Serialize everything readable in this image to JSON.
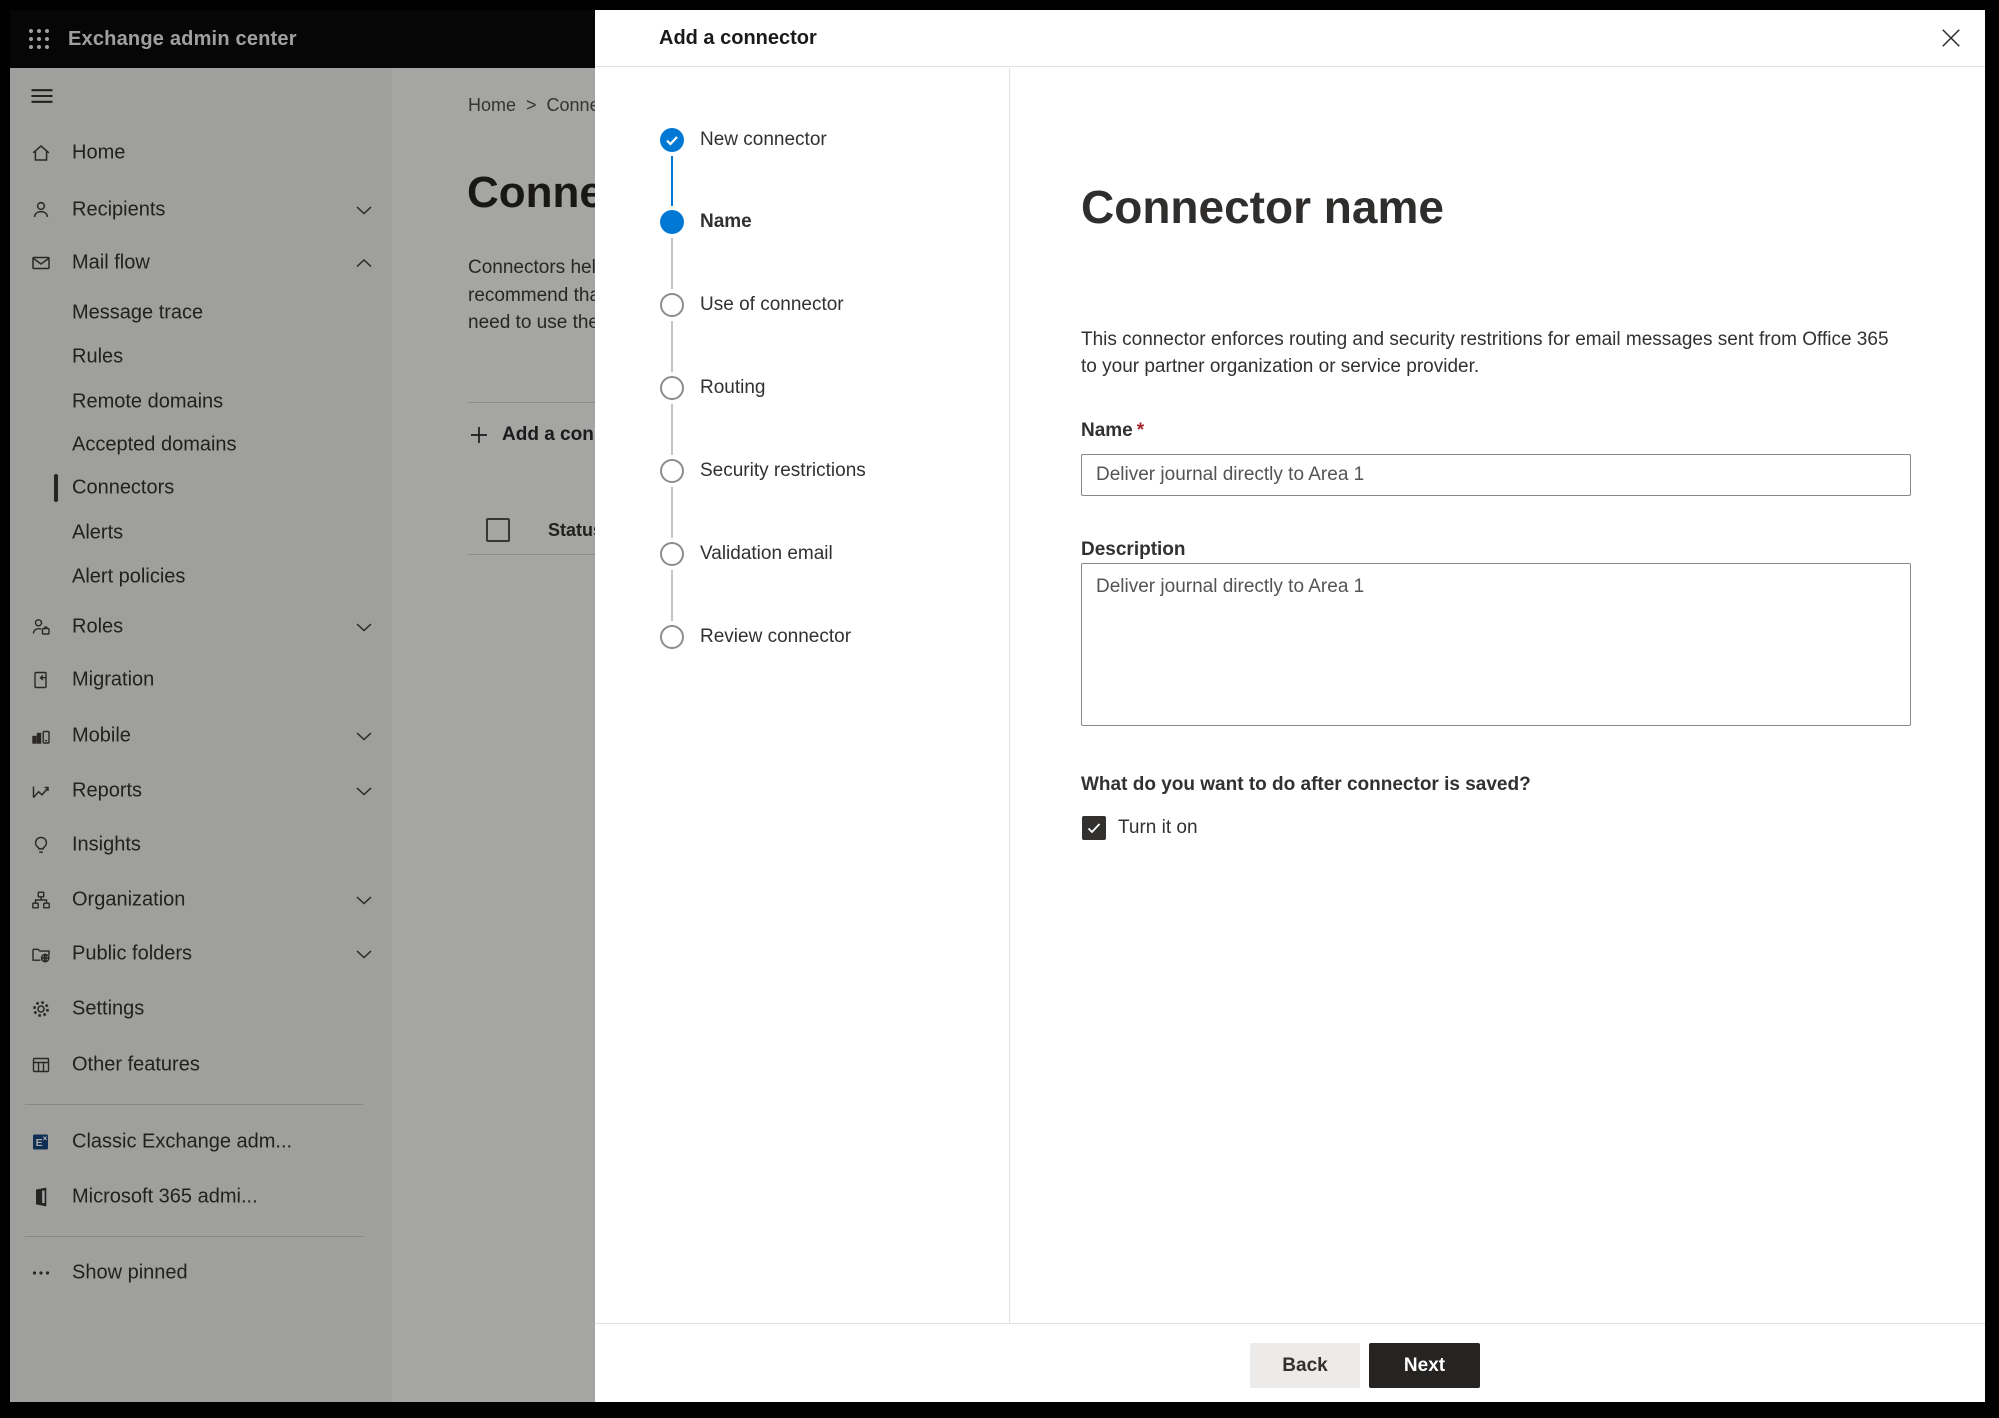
{
  "header": {
    "app_title": "Exchange admin center"
  },
  "sidebar": {
    "items": [
      {
        "label": "Home"
      },
      {
        "label": "Recipients"
      },
      {
        "label": "Mail flow"
      },
      {
        "label": "Message trace"
      },
      {
        "label": "Rules"
      },
      {
        "label": "Remote domains"
      },
      {
        "label": "Accepted domains"
      },
      {
        "label": "Connectors"
      },
      {
        "label": "Alerts"
      },
      {
        "label": "Alert policies"
      },
      {
        "label": "Roles"
      },
      {
        "label": "Migration"
      },
      {
        "label": "Mobile"
      },
      {
        "label": "Reports"
      },
      {
        "label": "Insights"
      },
      {
        "label": "Organization"
      },
      {
        "label": "Public folders"
      },
      {
        "label": "Settings"
      },
      {
        "label": "Other features"
      },
      {
        "label": "Classic Exchange adm..."
      },
      {
        "label": "Microsoft 365 admi..."
      },
      {
        "label": "Show pinned"
      }
    ]
  },
  "background": {
    "breadcrumb": {
      "home": "Home",
      "separator": ">",
      "current": "Conne"
    },
    "page_title": "Connec",
    "intro_lines": [
      "Connectors help",
      "recommend that",
      "need to use ther"
    ],
    "add_button_label": "Add a conn",
    "table": {
      "status_header": "Status"
    }
  },
  "dialog": {
    "title": "Add a connector",
    "steps": [
      {
        "label": "New connector",
        "state": "completed"
      },
      {
        "label": "Name",
        "state": "active"
      },
      {
        "label": "Use of connector",
        "state": "upcoming"
      },
      {
        "label": "Routing",
        "state": "upcoming"
      },
      {
        "label": "Security restrictions",
        "state": "upcoming"
      },
      {
        "label": "Validation email",
        "state": "upcoming"
      },
      {
        "label": "Review connector",
        "state": "upcoming"
      }
    ],
    "content": {
      "heading": "Connector name",
      "description_lines": [
        "This connector enforces routing and security restritions for email messages sent from Office 365",
        "to your partner organization or service provider."
      ],
      "name_label": "Name",
      "required_marker": "*",
      "name_value": "Deliver journal directly to Area 1",
      "description_label": "Description",
      "description_value": "Deliver journal directly to Area 1",
      "after_save_question": "What do you want to do after connector is saved?",
      "turn_on_label": "Turn it on",
      "turn_on_checked": true
    },
    "footer": {
      "back_label": "Back",
      "next_label": "Next"
    }
  },
  "colors": {
    "accent": "#0078d4",
    "danger": "#a4262c",
    "next_button_bg": "#252423",
    "back_button_bg": "#edebe9"
  }
}
